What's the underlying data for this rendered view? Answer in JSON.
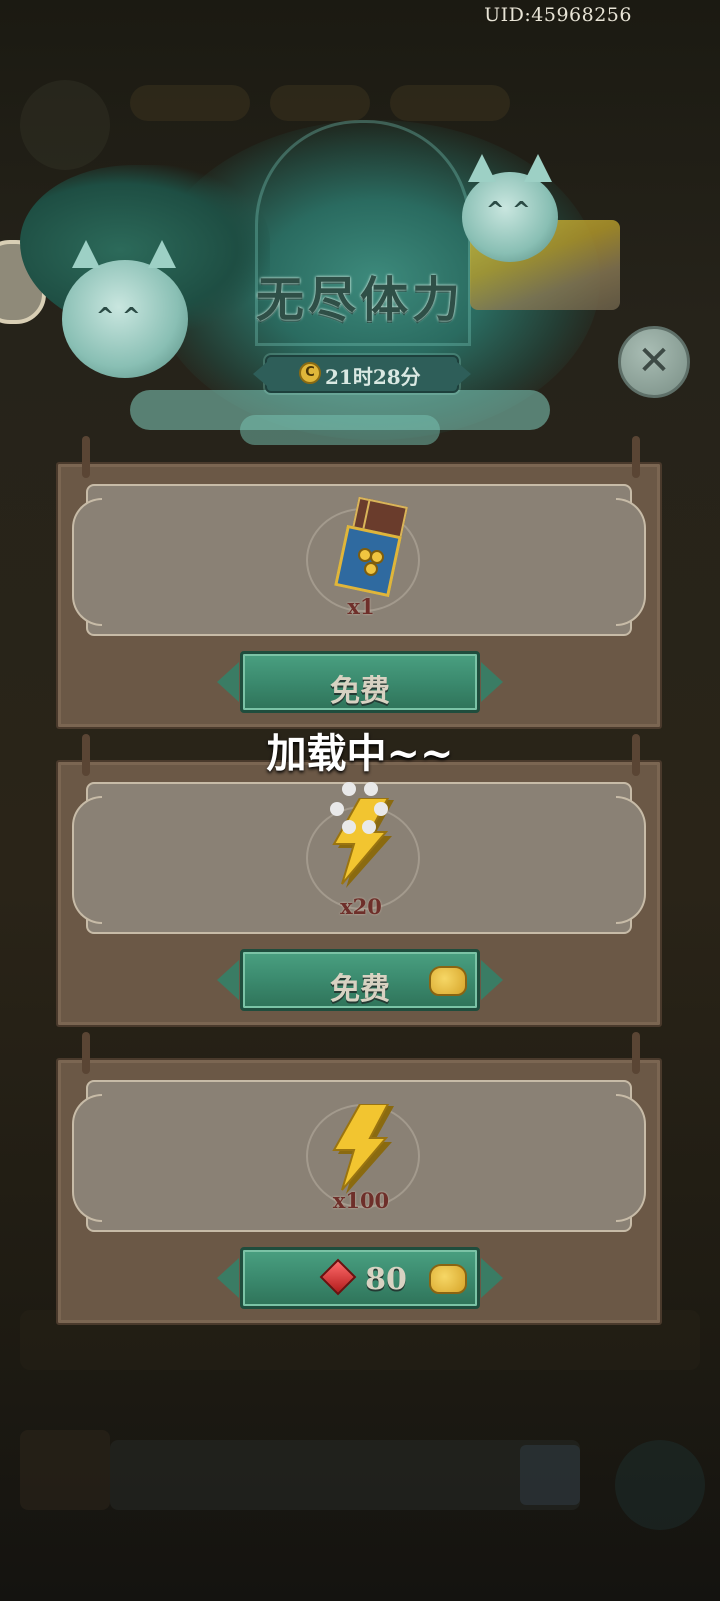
{
  "status_bar": {
    "uid": "UID:45968256"
  },
  "header": {
    "title": "无尽体力",
    "timer_icon": "C",
    "timer": "21时28分"
  },
  "cards": [
    {
      "item": "ticket-bundle",
      "quantity": "x1",
      "button_label": "免费",
      "badge_icon": ""
    },
    {
      "item": "energy-bolt",
      "quantity": "x20",
      "button_label": "免费",
      "badge_icon": "piggy-bank-icon"
    },
    {
      "item": "energy-bolt",
      "quantity": "x100",
      "button_label": "80",
      "badge_icon": "piggy-bank-icon",
      "currency_icon": "ruby-icon"
    }
  ],
  "overlay": {
    "loading_text": "加载中~~"
  },
  "colors": {
    "button_green": "#3b8a6e",
    "card_brown": "#6b5846",
    "panel": "#8a8175",
    "quantity_red": "#6e2f2a"
  }
}
